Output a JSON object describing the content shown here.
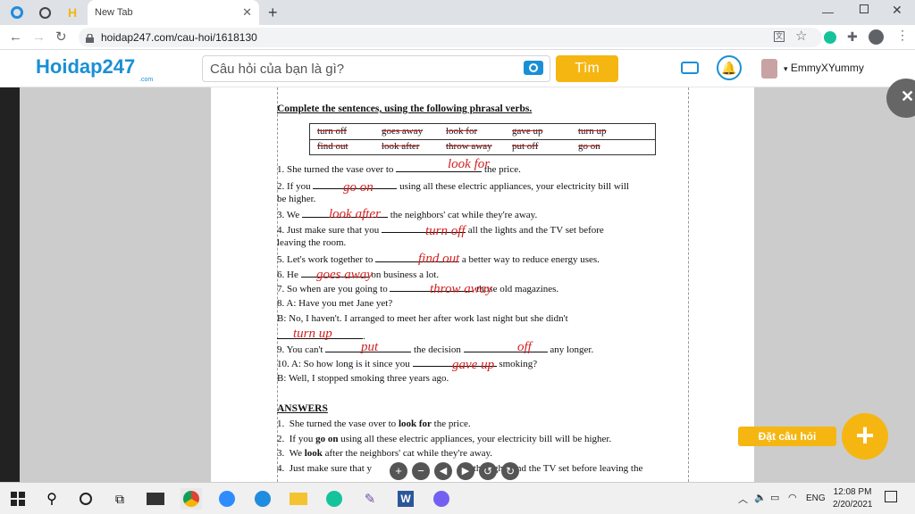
{
  "browser": {
    "tabs": [
      {
        "label": ""
      },
      {
        "label": ""
      },
      {
        "label": ""
      },
      {
        "label": "New Tab"
      }
    ],
    "new_tab_symbol": "+",
    "address": "hoidap247.com/cau-hoi/1618130"
  },
  "site": {
    "logo": "Hoidap247",
    "logo_sub": ".com",
    "search_placeholder": "Câu hỏi của bạn là gì?",
    "search_button": "Tìm",
    "username": "EmmyXYummy"
  },
  "document": {
    "heading": "Complete the sentences, using the following phrasal verbs.",
    "verb_box": [
      [
        "turn off",
        "goes away",
        "look for",
        "gave up",
        "turn up"
      ],
      [
        "find out",
        "look after",
        "throw away",
        "put off",
        "go on"
      ]
    ],
    "exercises": [
      {
        "pre": "1.  She turned the vase over to",
        "ans": "look for",
        "post": "the price."
      },
      {
        "pre": "2.  If you",
        "ans": "go on",
        "post": "using all these electric appliances, your electricity bill will"
      },
      {
        "pre": "be higher.",
        "ans": "",
        "post": ""
      },
      {
        "pre": "3.  We",
        "ans": "look after",
        "post": "the neighbors' cat while they're away."
      },
      {
        "pre": "4.  Just make sure that you",
        "ans": "turn off",
        "post": "all the lights and the TV set before"
      },
      {
        "pre": "leaving the room.",
        "ans": "",
        "post": ""
      },
      {
        "pre": "5.  Let's work together to",
        "ans": "find out",
        "post": "a better way to reduce energy uses."
      },
      {
        "pre": "6.  He",
        "ans": "goes away",
        "post": "on business a lot."
      },
      {
        "pre": "7.  So when are you going to",
        "ans": "throw away",
        "post": "those old magazines."
      },
      {
        "pre": "8.  A:  Have you met Jane yet?",
        "ans": "",
        "post": ""
      },
      {
        "pre": "     B:  No, I haven't. I arranged to meet her after work last night but she didn't",
        "ans": "",
        "post": ""
      },
      {
        "pre": "",
        "ans": "turn up",
        "post": "."
      },
      {
        "pre": "9.  You can't",
        "ans": "put",
        "post": "the decision",
        "ans2": "off",
        "post2": "any longer."
      },
      {
        "pre": "10. A:  So how long is it since you",
        "ans": "gave up",
        "post": "smoking?"
      },
      {
        "pre": "     B:  Well, I stopped smoking three years ago.",
        "ans": "",
        "post": ""
      }
    ],
    "answers_heading": "ANSWERS",
    "answers": [
      {
        "n": "1.",
        "pre": "She turned the vase over to",
        "bold": "look for",
        "post": "the price."
      },
      {
        "n": "2.",
        "pre": "If you",
        "bold": "go on",
        "post": "using all these electric appliances, your electricity bill will be higher."
      },
      {
        "n": "3.",
        "pre": "We",
        "bold": "look",
        "post": "after the neighbors' cat while they're away."
      },
      {
        "n": "4.",
        "pre": "Just make sure that y",
        "bold": "",
        "post": "all the lights and the TV set before leaving the"
      }
    ]
  },
  "fab": {
    "label": "Đặt câu hỏi"
  },
  "taskbar": {
    "lang": "ENG",
    "time": "12:08 PM",
    "date": "2/20/2021"
  },
  "colors": {
    "accent": "#f5b612",
    "brand_blue": "#1a8fd6",
    "answer_red": "#d21f1f"
  }
}
